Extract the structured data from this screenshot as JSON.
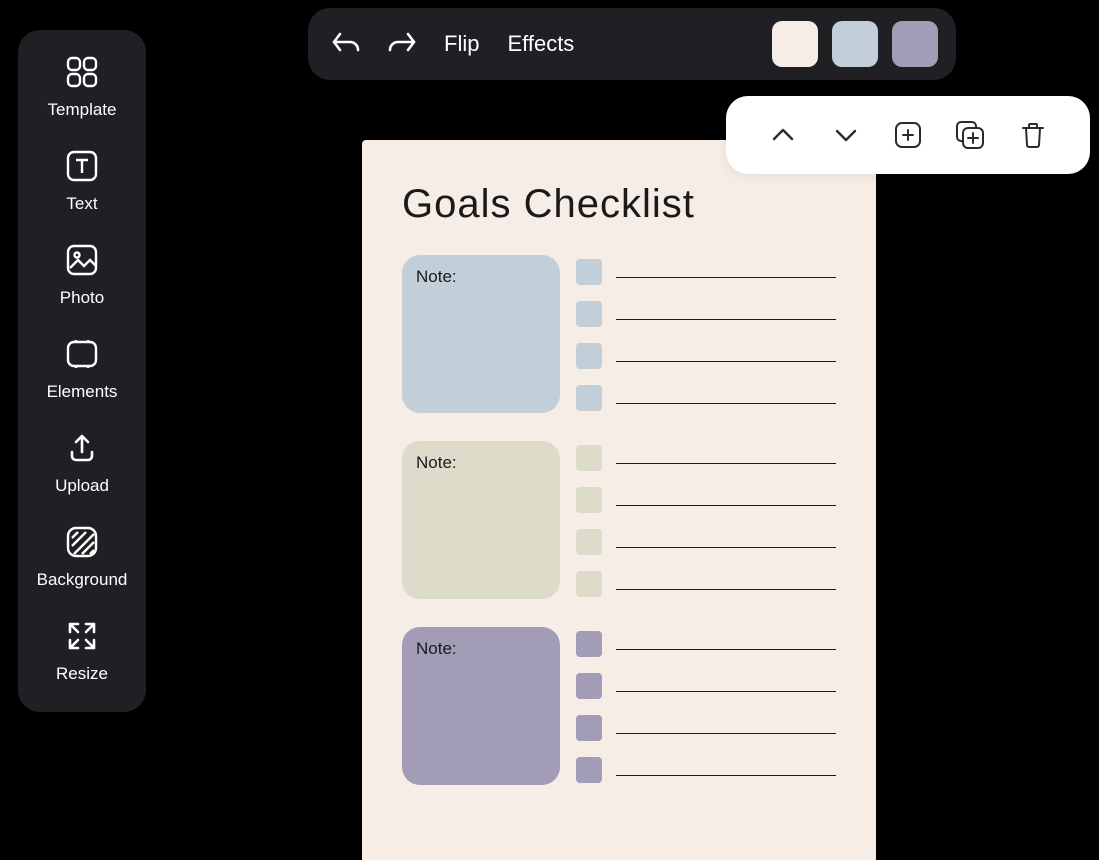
{
  "sidebar": {
    "items": [
      {
        "label": "Template"
      },
      {
        "label": "Text"
      },
      {
        "label": "Photo"
      },
      {
        "label": "Elements"
      },
      {
        "label": "Upload"
      },
      {
        "label": "Background"
      },
      {
        "label": "Resize"
      }
    ]
  },
  "toolbar": {
    "flip_label": "Flip",
    "effects_label": "Effects",
    "swatches": [
      "#f6ede7",
      "#c2cfd8",
      "#a39cb6"
    ]
  },
  "document": {
    "title": "Goals Checklist",
    "sections": [
      {
        "note_label": "Note:",
        "box_color": "#c2cfd8",
        "check_color": "#c2cfd8"
      },
      {
        "note_label": "Note:",
        "box_color": "#dddbc9",
        "check_color": "#dddbc9"
      },
      {
        "note_label": "Note:",
        "box_color": "#a39cb6",
        "check_color": "#a39cb6"
      }
    ]
  }
}
